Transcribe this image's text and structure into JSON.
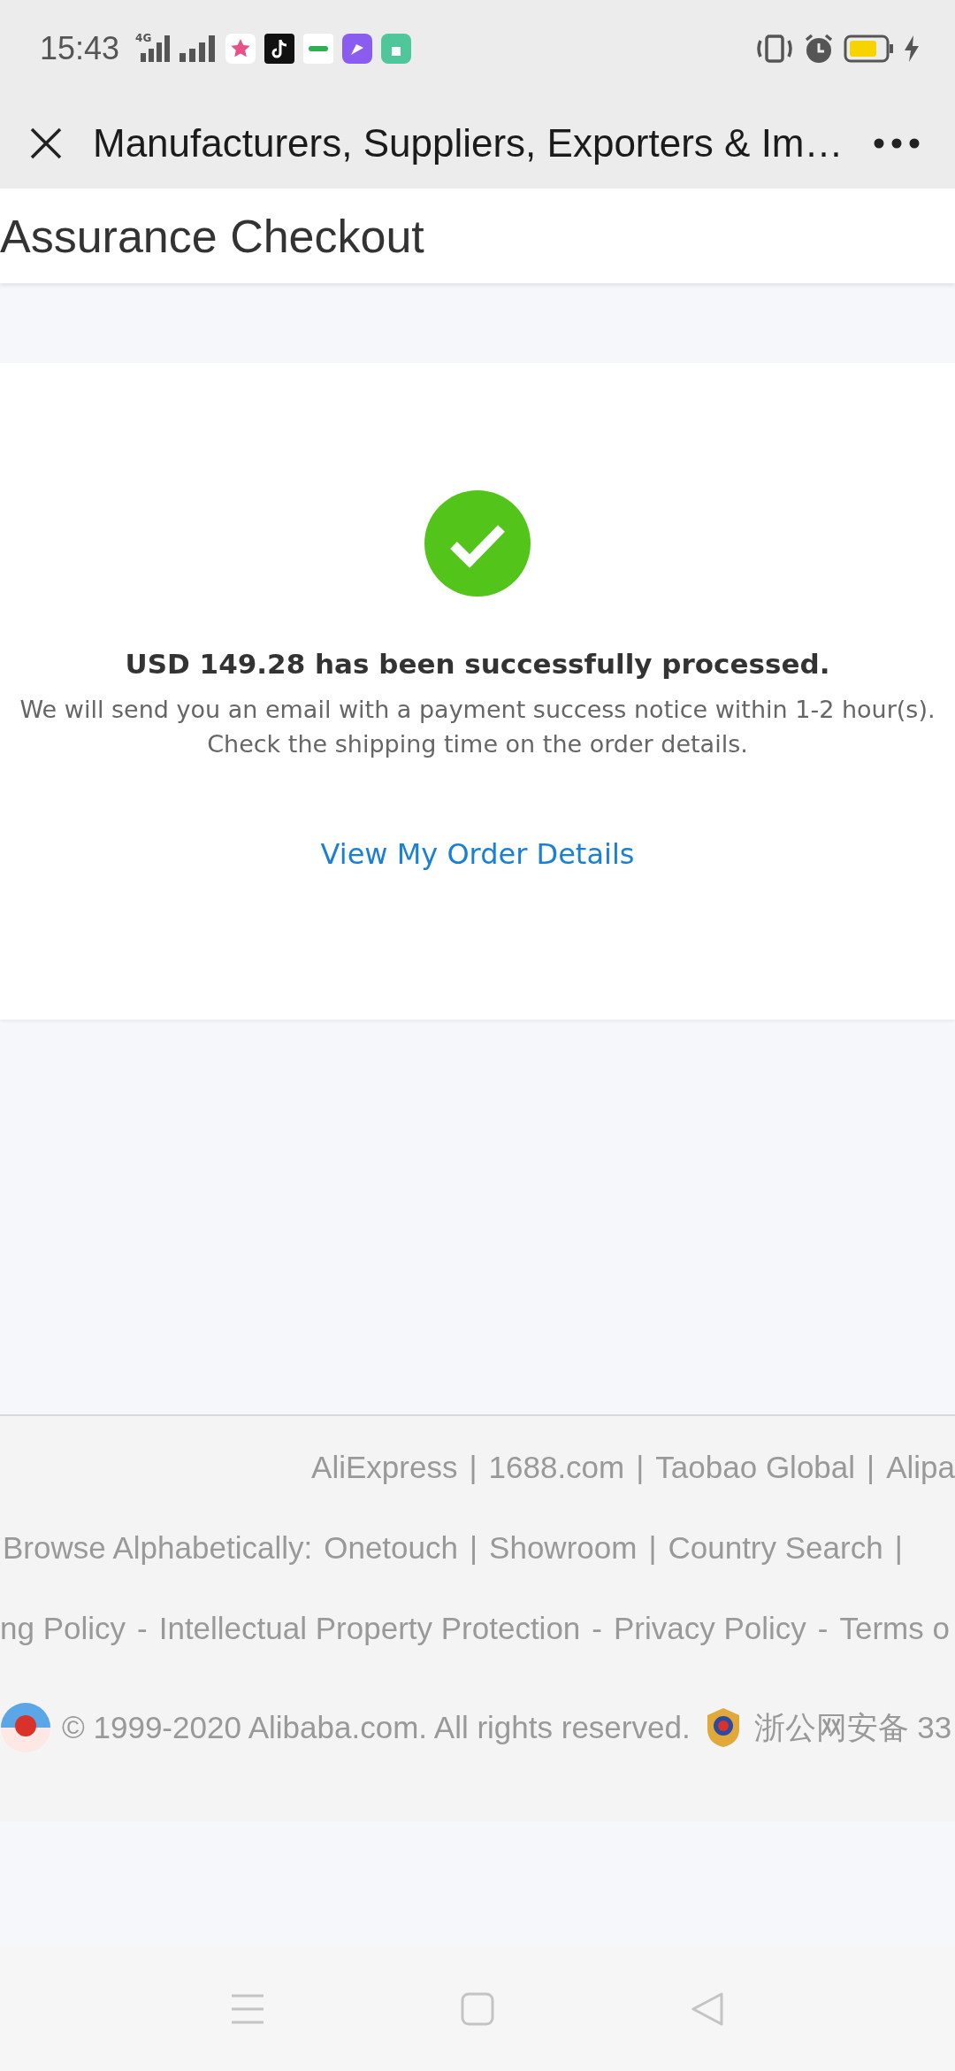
{
  "status_bar": {
    "time": "15:43",
    "network": "4G"
  },
  "browser_bar": {
    "title": "Manufacturers, Suppliers, Exporters & Im…"
  },
  "page": {
    "title": "Assurance Checkout"
  },
  "result": {
    "message": "USD 149.28 has been successfully processed.",
    "notice_lines": [
      "We will send you an email with a payment success notice within 1-2 hour(s).",
      "Check the shipping time on the order details."
    ],
    "link": "View My Order Details"
  },
  "footer": {
    "link_rows": [
      {
        "links": [
          "AliExpress",
          "1688.com",
          "Taobao Global",
          "Alipa"
        ],
        "separator": "|"
      },
      {
        "label": "Browse Alphabetically:",
        "links": [
          "Onetouch",
          "Showroom",
          "Country Search"
        ],
        "separator": "|",
        "tail": "|"
      },
      {
        "links": [
          "ng Policy",
          "Intellectual Property Protection",
          "Privacy Policy",
          "Terms o"
        ],
        "separator": "-"
      }
    ],
    "copyright": "© 1999-2020 Alibaba.com. All rights reserved.",
    "record": "浙公网安备 33"
  }
}
